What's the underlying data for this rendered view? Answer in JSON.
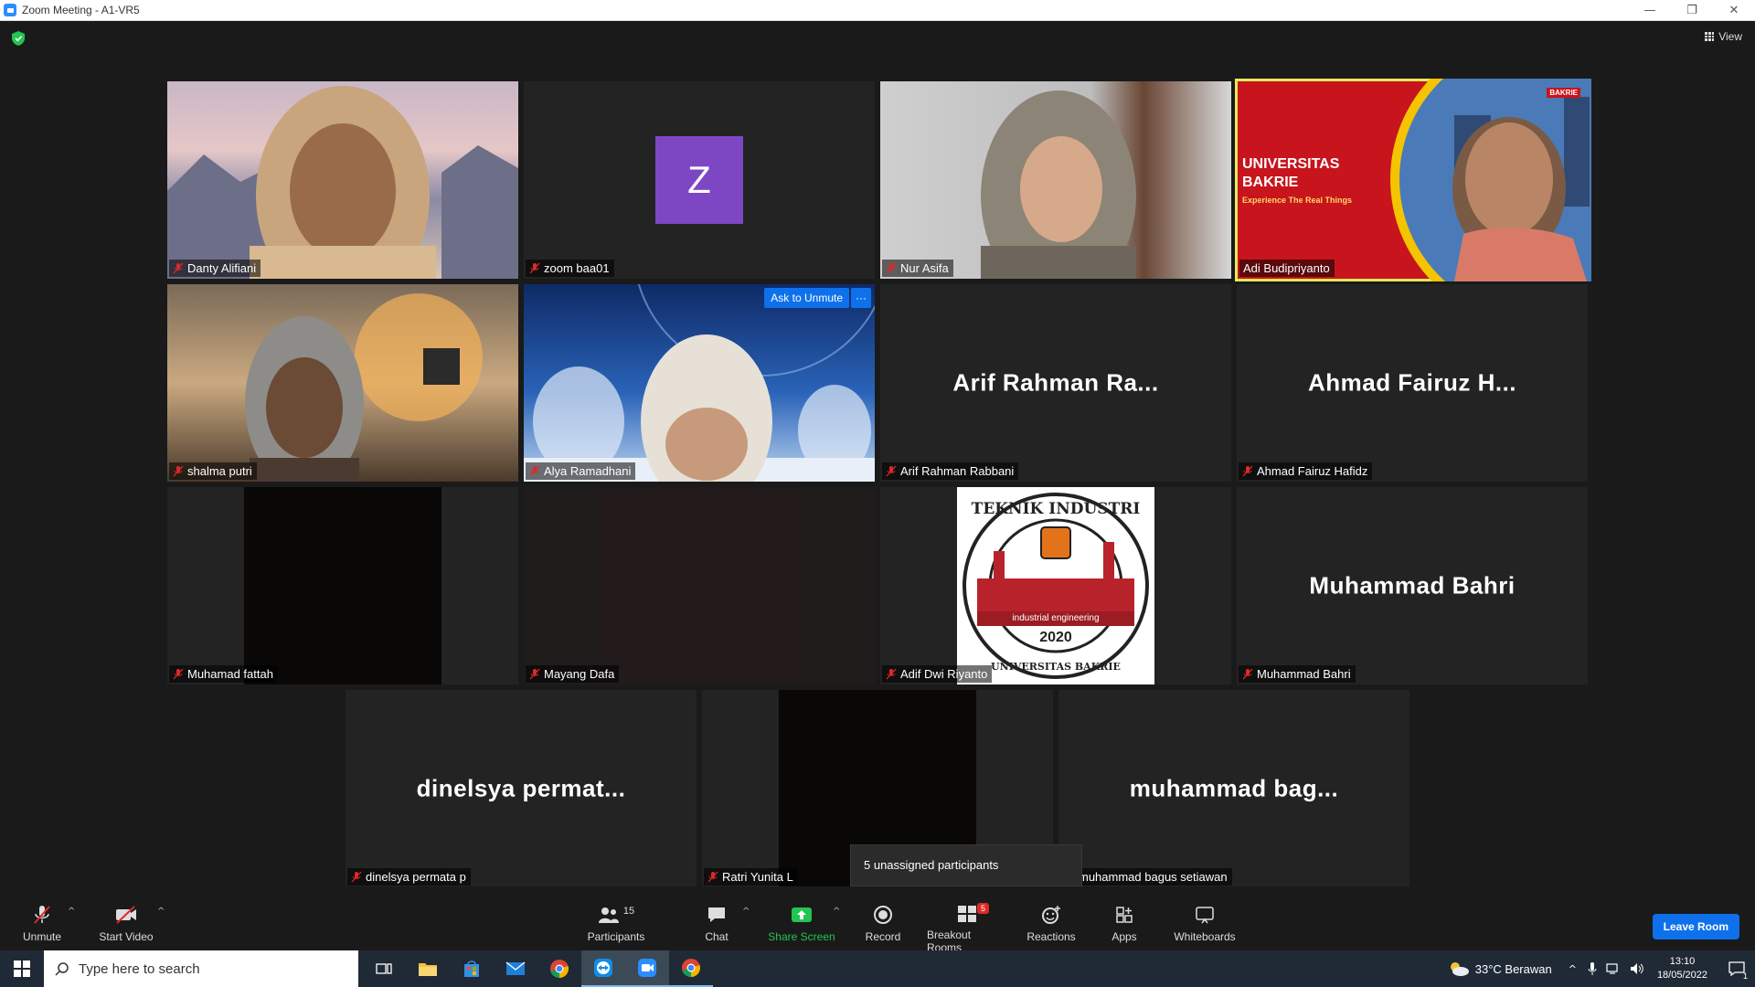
{
  "window": {
    "title": "Zoom Meeting - A1-VR5",
    "controls": [
      "—",
      "❐",
      "✕"
    ]
  },
  "header": {
    "view_label": "View"
  },
  "tiles": [
    {
      "name": "Danty Alifiani",
      "type": "video",
      "muted": true
    },
    {
      "name": "zoom baa01",
      "type": "avatar",
      "avatar_letter": "Z",
      "muted": true
    },
    {
      "name": "Nur Asifa",
      "type": "video",
      "muted": true
    },
    {
      "name": "Adi Budipriyanto",
      "type": "video",
      "muted": false,
      "active_speaker": true
    },
    {
      "name": "shalma putri",
      "type": "video",
      "muted": true
    },
    {
      "name": "Alya Ramadhani",
      "type": "video",
      "muted": true
    },
    {
      "name": "Arif Rahman Rabbani",
      "display_name": "Arif Rahman Ra...",
      "type": "name",
      "muted": true
    },
    {
      "name": "Ahmad Fairuz Hafidz",
      "display_name": "Ahmad Fairuz H...",
      "type": "name",
      "muted": true
    },
    {
      "name": "Muhamad fattah",
      "type": "video",
      "muted": true
    },
    {
      "name": "Mayang Dafa",
      "type": "video",
      "muted": true
    },
    {
      "name": "Adif Dwi Riyanto",
      "type": "video",
      "muted": true
    },
    {
      "name": "Muhammad Bahri",
      "display_name": "Muhammad Bahri",
      "type": "name",
      "muted": true
    },
    {
      "name": "dinelsya permata p",
      "display_name": "dinelsya permat...",
      "type": "name",
      "muted": true
    },
    {
      "name": "Ratri Yunita L",
      "type": "video",
      "muted": true
    },
    {
      "name": "muhammad bagus setiawan",
      "display_name": "muhammad bag...",
      "type": "name",
      "muted": true
    }
  ],
  "speaker_slide": {
    "line1": "UNIVERSITAS",
    "line2": "BAKRIE",
    "tagline": "Experience The Real Things",
    "brand_small": "BAKRIE"
  },
  "logo": {
    "top_text": "TEKNIK INDUSTRI",
    "middle_text": "industrial engineering",
    "year": "2020",
    "bottom_text": "UNIVERSITAS BAKRIE"
  },
  "hover_actions": {
    "ask_to_unmute": "Ask to Unmute",
    "more": "···"
  },
  "tooltip": "5 unassigned participants",
  "toolbar": {
    "unmute": "Unmute",
    "start_video": "Start Video",
    "participants": "Participants",
    "participants_count": "15",
    "chat": "Chat",
    "share_screen": "Share Screen",
    "record": "Record",
    "breakout_rooms": "Breakout Rooms",
    "breakout_badge": "5",
    "reactions": "Reactions",
    "apps": "Apps",
    "whiteboards": "Whiteboards",
    "leave_room": "Leave Room"
  },
  "taskbar": {
    "search_placeholder": "Type here to search",
    "weather": "33°C  Berawan",
    "time": "13:10",
    "date": "18/05/2022",
    "notification_count": "1"
  },
  "colors": {
    "accent_blue": "#0e71eb",
    "speaker_border": "#e6e85a",
    "share_green": "#23c552",
    "avatar_purple": "#7d47c4",
    "mute_red": "#e02828"
  }
}
